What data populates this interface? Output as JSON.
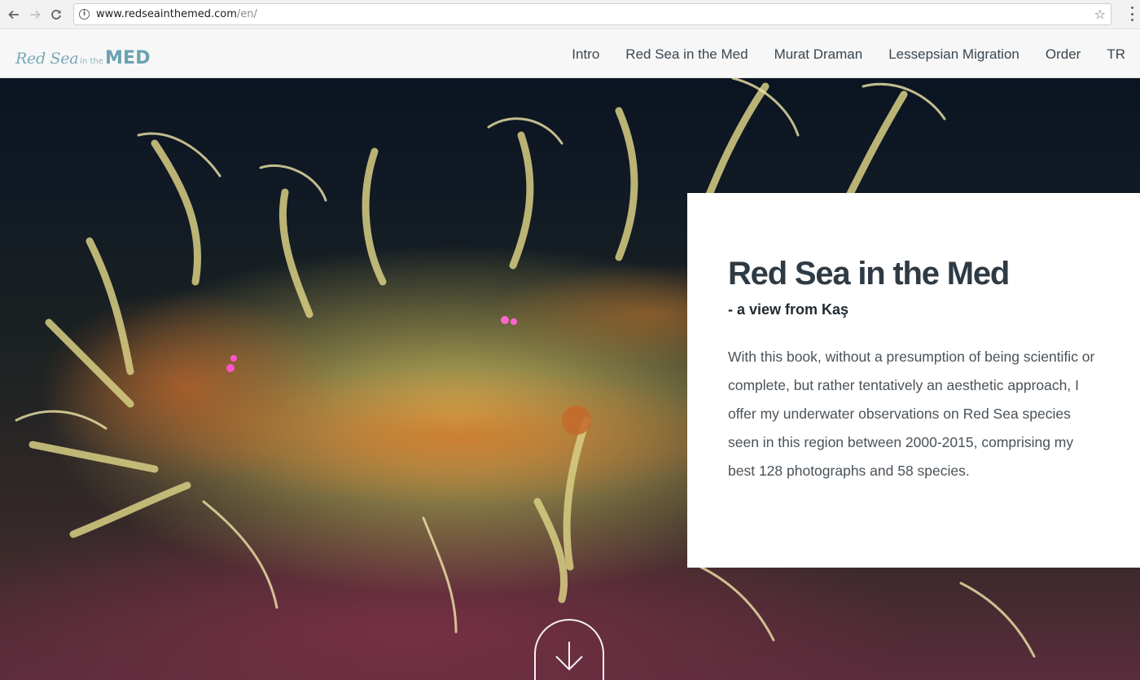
{
  "browser": {
    "url_host": "www.redseainthemed.com",
    "url_path": "/en/"
  },
  "site": {
    "logo": {
      "part1": "Red Sea",
      "part2": "in the",
      "part3": "MED"
    },
    "nav": [
      {
        "label": "Intro"
      },
      {
        "label": "Red Sea in the Med"
      },
      {
        "label": "Murat Draman"
      },
      {
        "label": "Lessepsian Migration"
      },
      {
        "label": "Order"
      },
      {
        "label": "TR"
      }
    ]
  },
  "hero": {
    "title": "Red Sea in the Med",
    "subtitle": "- a view from Kaş",
    "body": "With this book, without a presumption of being scientific or complete, but rather tentatively an aesthetic approach, I offer my underwater observations on Red Sea species seen in this region between 2000-2015, comprising my best 128 photographs and 58 species."
  },
  "colors": {
    "accent": "#6fa6b4",
    "title": "#2e3a44",
    "body": "#4a5258"
  }
}
